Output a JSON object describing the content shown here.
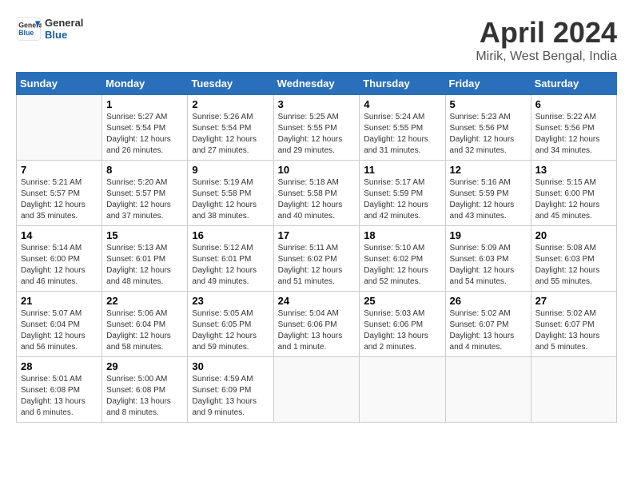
{
  "logo": {
    "line1": "General",
    "line2": "Blue"
  },
  "title": "April 2024",
  "subtitle": "Mirik, West Bengal, India",
  "weekdays": [
    "Sunday",
    "Monday",
    "Tuesday",
    "Wednesday",
    "Thursday",
    "Friday",
    "Saturday"
  ],
  "weeks": [
    [
      {
        "day": "",
        "info": ""
      },
      {
        "day": "1",
        "info": "Sunrise: 5:27 AM\nSunset: 5:54 PM\nDaylight: 12 hours\nand 26 minutes."
      },
      {
        "day": "2",
        "info": "Sunrise: 5:26 AM\nSunset: 5:54 PM\nDaylight: 12 hours\nand 27 minutes."
      },
      {
        "day": "3",
        "info": "Sunrise: 5:25 AM\nSunset: 5:55 PM\nDaylight: 12 hours\nand 29 minutes."
      },
      {
        "day": "4",
        "info": "Sunrise: 5:24 AM\nSunset: 5:55 PM\nDaylight: 12 hours\nand 31 minutes."
      },
      {
        "day": "5",
        "info": "Sunrise: 5:23 AM\nSunset: 5:56 PM\nDaylight: 12 hours\nand 32 minutes."
      },
      {
        "day": "6",
        "info": "Sunrise: 5:22 AM\nSunset: 5:56 PM\nDaylight: 12 hours\nand 34 minutes."
      }
    ],
    [
      {
        "day": "7",
        "info": "Sunrise: 5:21 AM\nSunset: 5:57 PM\nDaylight: 12 hours\nand 35 minutes."
      },
      {
        "day": "8",
        "info": "Sunrise: 5:20 AM\nSunset: 5:57 PM\nDaylight: 12 hours\nand 37 minutes."
      },
      {
        "day": "9",
        "info": "Sunrise: 5:19 AM\nSunset: 5:58 PM\nDaylight: 12 hours\nand 38 minutes."
      },
      {
        "day": "10",
        "info": "Sunrise: 5:18 AM\nSunset: 5:58 PM\nDaylight: 12 hours\nand 40 minutes."
      },
      {
        "day": "11",
        "info": "Sunrise: 5:17 AM\nSunset: 5:59 PM\nDaylight: 12 hours\nand 42 minutes."
      },
      {
        "day": "12",
        "info": "Sunrise: 5:16 AM\nSunset: 5:59 PM\nDaylight: 12 hours\nand 43 minutes."
      },
      {
        "day": "13",
        "info": "Sunrise: 5:15 AM\nSunset: 6:00 PM\nDaylight: 12 hours\nand 45 minutes."
      }
    ],
    [
      {
        "day": "14",
        "info": "Sunrise: 5:14 AM\nSunset: 6:00 PM\nDaylight: 12 hours\nand 46 minutes."
      },
      {
        "day": "15",
        "info": "Sunrise: 5:13 AM\nSunset: 6:01 PM\nDaylight: 12 hours\nand 48 minutes."
      },
      {
        "day": "16",
        "info": "Sunrise: 5:12 AM\nSunset: 6:01 PM\nDaylight: 12 hours\nand 49 minutes."
      },
      {
        "day": "17",
        "info": "Sunrise: 5:11 AM\nSunset: 6:02 PM\nDaylight: 12 hours\nand 51 minutes."
      },
      {
        "day": "18",
        "info": "Sunrise: 5:10 AM\nSunset: 6:02 PM\nDaylight: 12 hours\nand 52 minutes."
      },
      {
        "day": "19",
        "info": "Sunrise: 5:09 AM\nSunset: 6:03 PM\nDaylight: 12 hours\nand 54 minutes."
      },
      {
        "day": "20",
        "info": "Sunrise: 5:08 AM\nSunset: 6:03 PM\nDaylight: 12 hours\nand 55 minutes."
      }
    ],
    [
      {
        "day": "21",
        "info": "Sunrise: 5:07 AM\nSunset: 6:04 PM\nDaylight: 12 hours\nand 56 minutes."
      },
      {
        "day": "22",
        "info": "Sunrise: 5:06 AM\nSunset: 6:04 PM\nDaylight: 12 hours\nand 58 minutes."
      },
      {
        "day": "23",
        "info": "Sunrise: 5:05 AM\nSunset: 6:05 PM\nDaylight: 12 hours\nand 59 minutes."
      },
      {
        "day": "24",
        "info": "Sunrise: 5:04 AM\nSunset: 6:06 PM\nDaylight: 13 hours\nand 1 minute."
      },
      {
        "day": "25",
        "info": "Sunrise: 5:03 AM\nSunset: 6:06 PM\nDaylight: 13 hours\nand 2 minutes."
      },
      {
        "day": "26",
        "info": "Sunrise: 5:02 AM\nSunset: 6:07 PM\nDaylight: 13 hours\nand 4 minutes."
      },
      {
        "day": "27",
        "info": "Sunrise: 5:02 AM\nSunset: 6:07 PM\nDaylight: 13 hours\nand 5 minutes."
      }
    ],
    [
      {
        "day": "28",
        "info": "Sunrise: 5:01 AM\nSunset: 6:08 PM\nDaylight: 13 hours\nand 6 minutes."
      },
      {
        "day": "29",
        "info": "Sunrise: 5:00 AM\nSunset: 6:08 PM\nDaylight: 13 hours\nand 8 minutes."
      },
      {
        "day": "30",
        "info": "Sunrise: 4:59 AM\nSunset: 6:09 PM\nDaylight: 13 hours\nand 9 minutes."
      },
      {
        "day": "",
        "info": ""
      },
      {
        "day": "",
        "info": ""
      },
      {
        "day": "",
        "info": ""
      },
      {
        "day": "",
        "info": ""
      }
    ]
  ]
}
